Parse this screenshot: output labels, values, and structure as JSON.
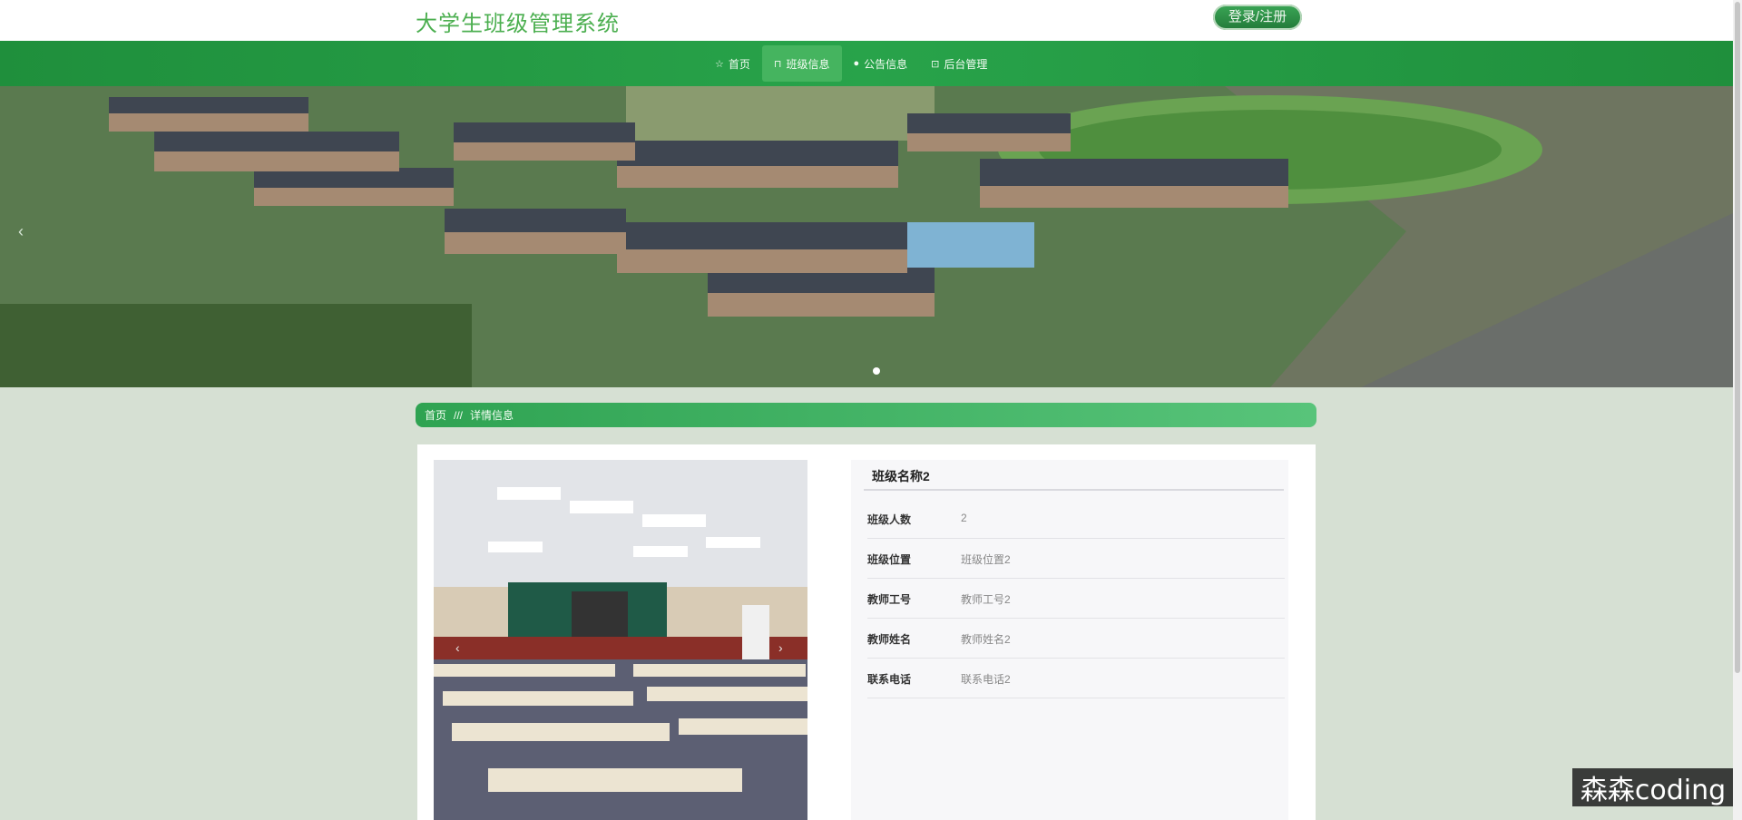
{
  "header": {
    "site_title": "大学生班级管理系统",
    "login_button": "登录/注册"
  },
  "nav": {
    "items": [
      {
        "label": "首页",
        "icon": "star-icon"
      },
      {
        "label": "班级信息",
        "icon": "bag-icon"
      },
      {
        "label": "公告信息",
        "icon": "info-icon"
      },
      {
        "label": "后台管理",
        "icon": "dashboard-icon"
      }
    ]
  },
  "banner": {
    "prev": "‹",
    "next": "›"
  },
  "breadcrumb": {
    "home": "首页",
    "separator": "///",
    "current": "详情信息"
  },
  "detail": {
    "title": "班级名称2",
    "rows": [
      {
        "label": "班级人数",
        "value": "2"
      },
      {
        "label": "班级位置",
        "value": "班级位置2"
      },
      {
        "label": "教师工号",
        "value": "教师工号2"
      },
      {
        "label": "教师姓名",
        "value": "教师姓名2"
      },
      {
        "label": "联系电话",
        "value": "联系电话2"
      }
    ]
  },
  "photo": {
    "prev": "‹",
    "next": "›"
  },
  "watermark": "森森coding",
  "colors": {
    "accent": "#28a34a",
    "page_bg": "#d6e0d3"
  }
}
